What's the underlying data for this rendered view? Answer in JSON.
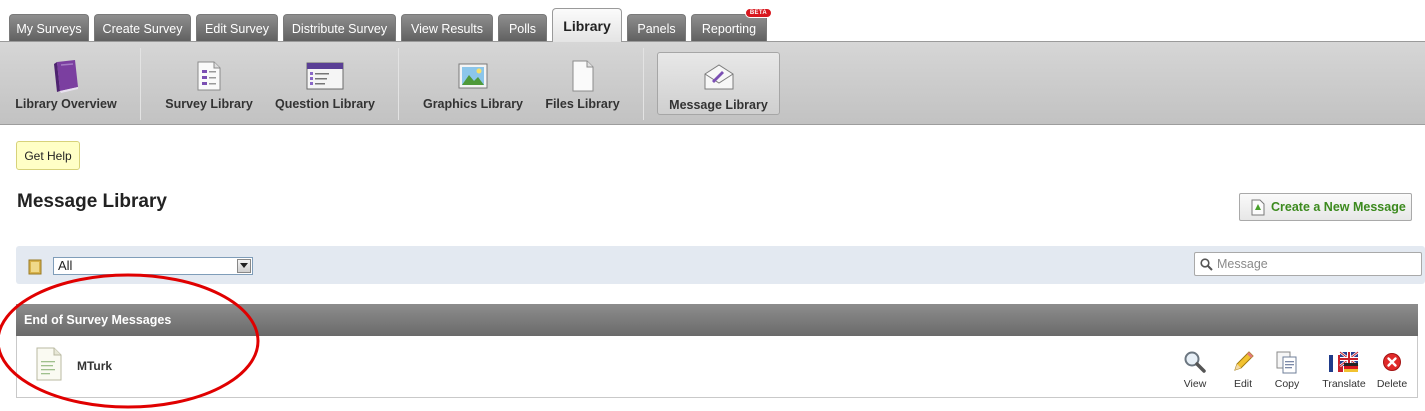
{
  "tabs": [
    {
      "label": "My Surveys"
    },
    {
      "label": "Create Survey"
    },
    {
      "label": "Edit Survey"
    },
    {
      "label": "Distribute Survey"
    },
    {
      "label": "View Results"
    },
    {
      "label": "Polls"
    },
    {
      "label": "Library",
      "active": true
    },
    {
      "label": "Panels"
    },
    {
      "label": "Reporting",
      "badge": "BETA"
    }
  ],
  "subnav": {
    "items": [
      {
        "label": "Library Overview",
        "icon": "book-icon"
      },
      {
        "label": "Survey Library",
        "icon": "survey-doc-icon"
      },
      {
        "label": "Question Library",
        "icon": "question-list-icon"
      },
      {
        "label": "Graphics Library",
        "icon": "picture-icon"
      },
      {
        "label": "Files Library",
        "icon": "file-icon"
      },
      {
        "label": "Message Library",
        "icon": "envelope-icon",
        "active": true
      }
    ]
  },
  "help": {
    "label": "Get Help"
  },
  "page": {
    "title": "Message Library"
  },
  "create_button": {
    "label": "Create a New Message"
  },
  "filter": {
    "selected": "All"
  },
  "search": {
    "placeholder": "Message"
  },
  "group": {
    "title": "End of Survey Messages"
  },
  "messages": [
    {
      "name": "MTurk"
    }
  ],
  "actions": [
    {
      "label": "View",
      "icon": "magnifier-icon"
    },
    {
      "label": "Edit",
      "icon": "pencil-icon"
    },
    {
      "label": "Copy",
      "icon": "copy-icon"
    },
    {
      "label": "Translate",
      "icon": "flags-icon"
    },
    {
      "label": "Delete",
      "icon": "delete-icon"
    }
  ],
  "colors": {
    "annotation": "#e00000",
    "create_label": "#3c8a1e",
    "filter_bg": "#e3e9f1",
    "group_header": "#7a7a7a"
  }
}
